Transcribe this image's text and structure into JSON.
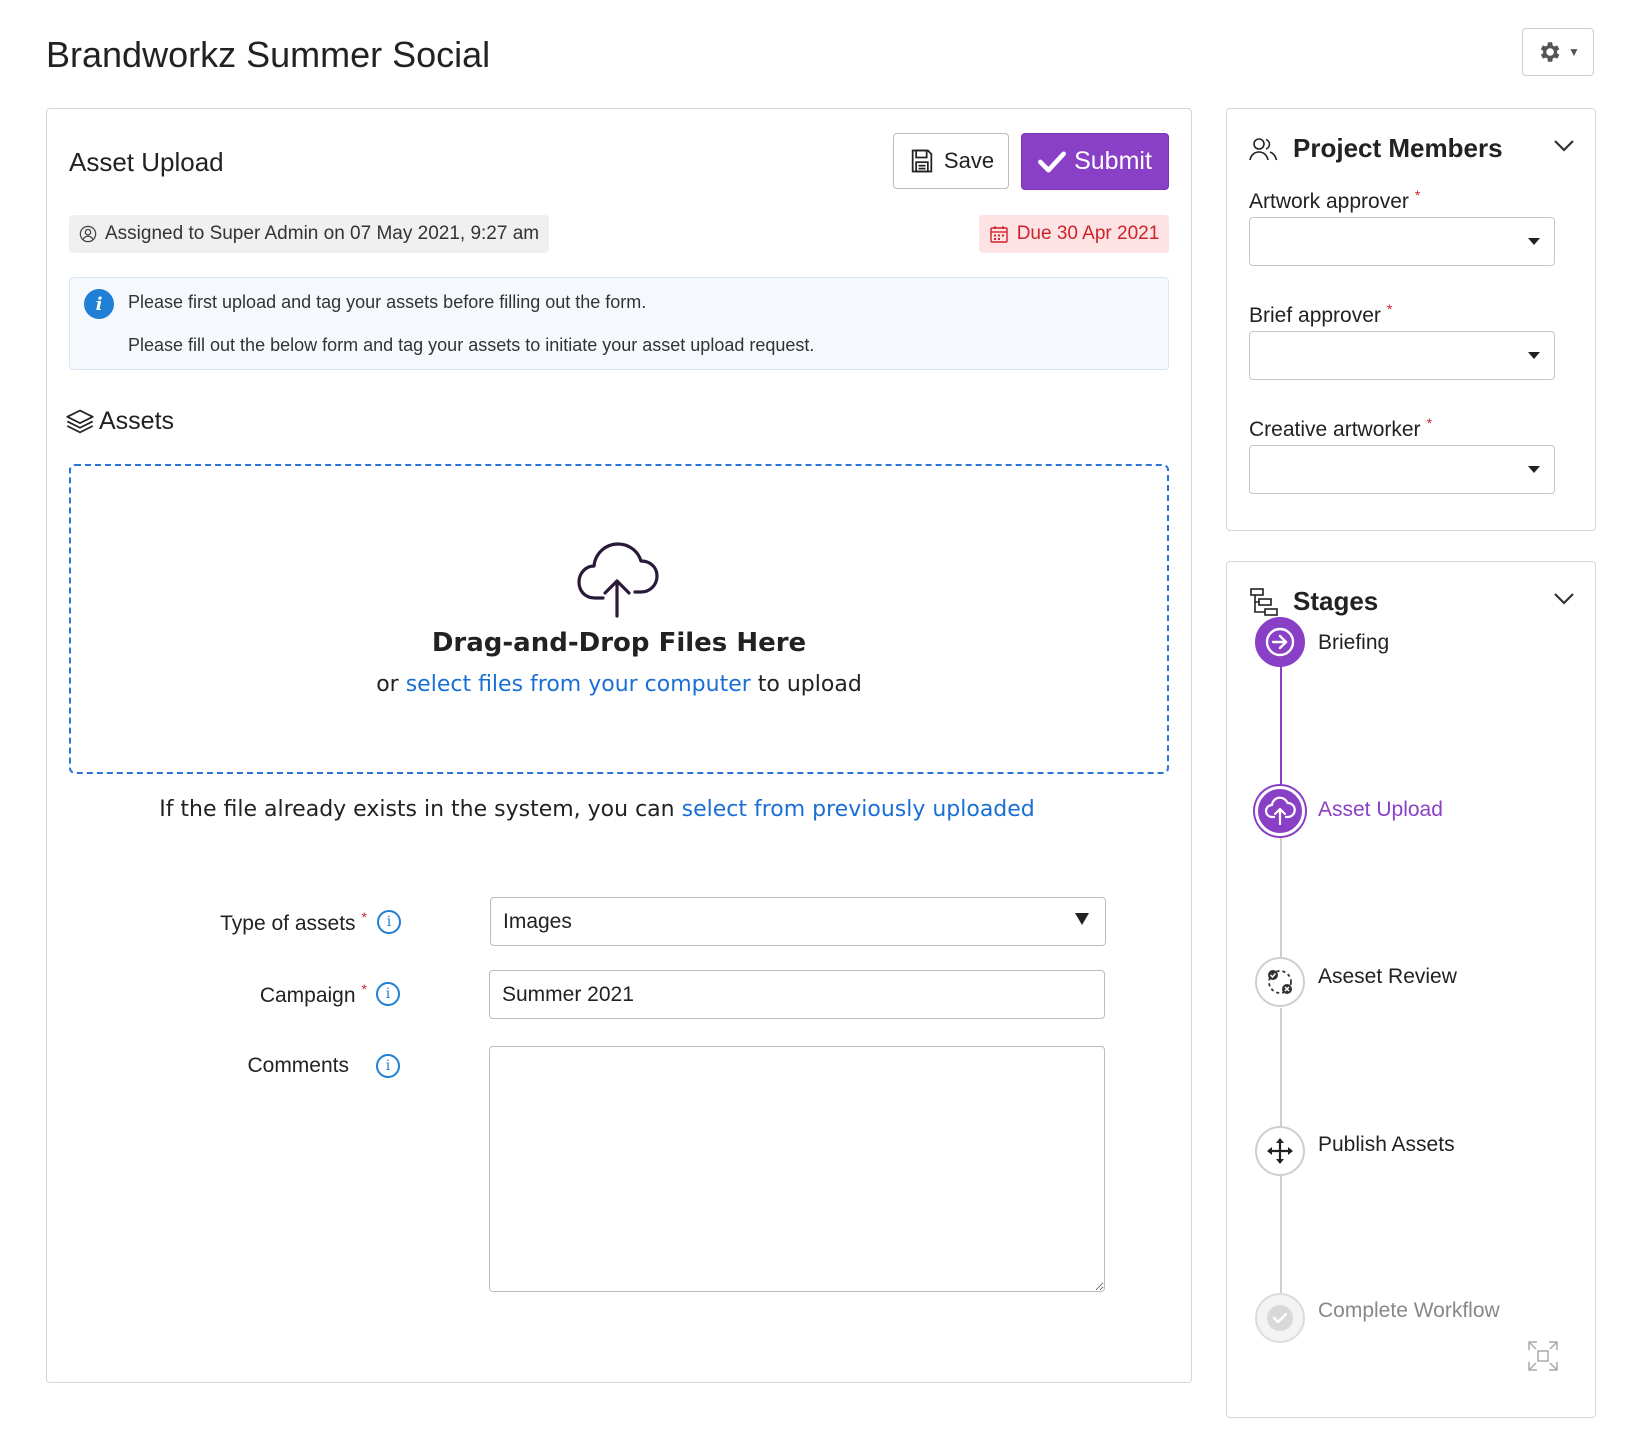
{
  "page": {
    "title": "Brandworkz Summer Social"
  },
  "task": {
    "title": "Asset Upload",
    "save_label": "Save",
    "submit_label": "Submit",
    "assigned_text": "Assigned to Super Admin on 07 May 2021, 9:27 am",
    "due_text": "Due 30 Apr 2021",
    "info_icon": "i",
    "info_line1": "Please first upload and tag your assets before filling out the form.",
    "info_line2": "Please fill out the below form and tag your assets to initiate your asset upload request."
  },
  "assets": {
    "heading": "Assets",
    "dropzone_title": "Drag-and-Drop Files Here",
    "dropzone_prefix": "or",
    "dropzone_link": "select files from your computer",
    "dropzone_suffix": "to upload",
    "previous_prefix": "If the file already exists in the system, you can",
    "previous_link": "select from previously uploaded"
  },
  "form": {
    "required_mark": "*",
    "info_glyph": "i",
    "type_label": "Type of assets",
    "type_value": "Images",
    "campaign_label": "Campaign",
    "campaign_value": "Summer 2021",
    "comments_label": "Comments",
    "comments_value": ""
  },
  "members": {
    "title": "Project Members",
    "fields": [
      {
        "label": "Artwork approver",
        "value": ""
      },
      {
        "label": "Brief approver",
        "value": ""
      },
      {
        "label": "Creative artworker",
        "value": ""
      }
    ]
  },
  "stages": {
    "title": "Stages",
    "items": [
      {
        "label": "Briefing",
        "status": "completed"
      },
      {
        "label": "Asset Upload",
        "status": "current"
      },
      {
        "label": "Aseset Review",
        "status": "pending"
      },
      {
        "label": "Publish Assets",
        "status": "pending"
      },
      {
        "label": "Complete Workflow",
        "status": "disabled"
      }
    ]
  },
  "colors": {
    "accent": "#8a3fc7",
    "link": "#1a6fd6",
    "danger": "#d0212a",
    "info": "#1f7fd4"
  },
  "icons": {
    "settings": "gear-icon",
    "save": "floppy-disk-icon",
    "submit": "checkmark-icon",
    "assigned": "user-circle-icon",
    "due": "calendar-icon",
    "assets": "layers-icon",
    "upload": "cloud-upload-icon",
    "members": "users-icon",
    "stages": "hierarchy-icon",
    "expand": "expand-icon"
  }
}
